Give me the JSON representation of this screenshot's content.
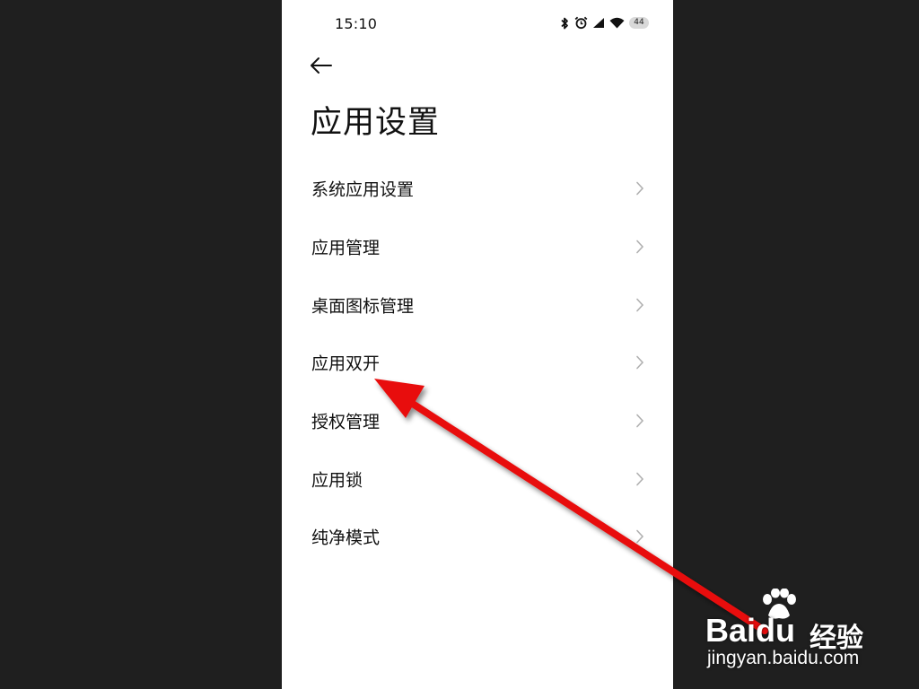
{
  "status_bar": {
    "time": "15:10",
    "icons": [
      "bluetooth-icon",
      "alarm-icon",
      "cellular-signal-icon",
      "wifi-icon"
    ],
    "battery": "44"
  },
  "header": {
    "back_icon": "arrow-left-icon",
    "title": "应用设置"
  },
  "settings": {
    "items": [
      {
        "label": "系统应用设置",
        "icon": "chevron-right-icon"
      },
      {
        "label": "应用管理",
        "icon": "chevron-right-icon"
      },
      {
        "label": "桌面图标管理",
        "icon": "chevron-right-icon"
      },
      {
        "label": "应用双开",
        "icon": "chevron-right-icon"
      },
      {
        "label": "授权管理",
        "icon": "chevron-right-icon"
      },
      {
        "label": "应用锁",
        "icon": "chevron-right-icon"
      },
      {
        "label": "纯净模式",
        "icon": "chevron-right-icon"
      }
    ]
  },
  "annotation": {
    "arrow_color": "#e8110f",
    "points_to": "应用双开"
  },
  "watermark": {
    "brand": "Bai",
    "brand_suffix": "du",
    "brand_cn": "经验",
    "url": "jingyan.baidu.com"
  },
  "colors": {
    "page_background": "#1f1f1f",
    "screen_background": "#ffffff",
    "text": "#111111",
    "chevron": "#b0b0b0"
  }
}
